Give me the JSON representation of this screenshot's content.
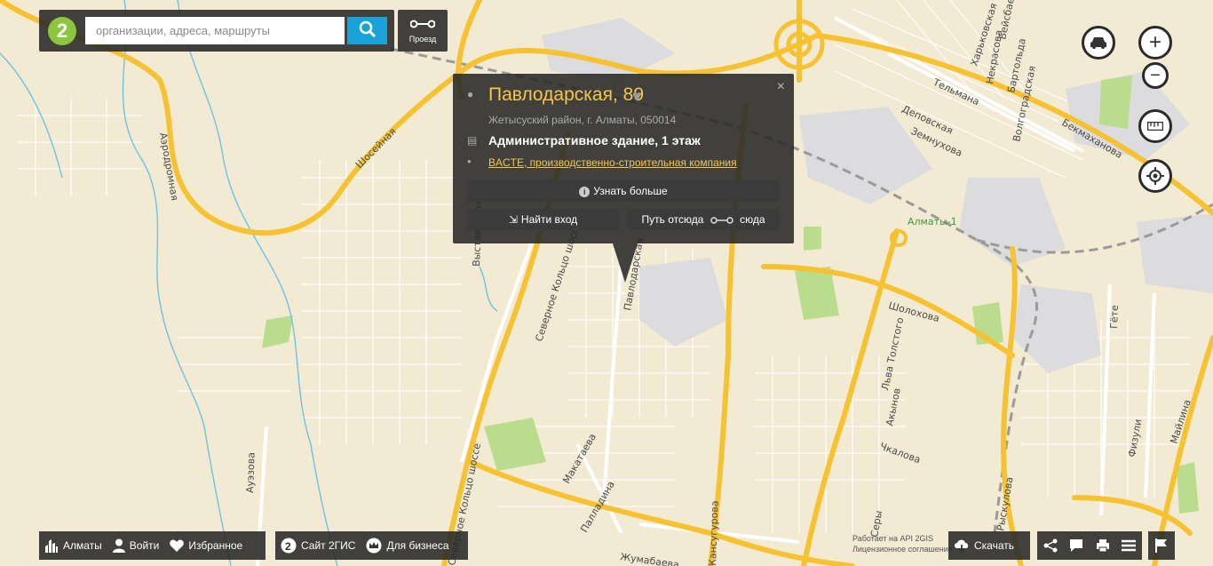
{
  "search": {
    "placeholder": "организации, адреса, маршруты",
    "route_label": "Проезд"
  },
  "popup": {
    "title": "Павлодарская, 89",
    "address": "Жетысуский район, г. Алматы, 050014",
    "building": "Административное здание, 1 этаж",
    "company": "BACTE, производственно-строительная компания",
    "learn_more": "Узнать больше",
    "find_entrance": "Найти вход",
    "route_from": "Путь отсюда",
    "route_to": "сюда",
    "close": "×"
  },
  "controls": {
    "traffic": "car-icon",
    "zoom_in": "+",
    "zoom_out": "−",
    "ruler": "ruler-icon",
    "locate": "locate-icon"
  },
  "bottom_left": {
    "city": "Алматы",
    "login": "Войти",
    "favorites": "Избранное",
    "site": "Сайт 2ГИС",
    "business": "Для бизнеса"
  },
  "bottom_right": {
    "download": "Скачать",
    "legal_line1": "Работает на API 2GIS",
    "legal_line2": "Лицензионное соглашение"
  },
  "map": {
    "streets": [
      {
        "name": "Шосейная"
      },
      {
        "name": "Северное Кольцо шоссе"
      },
      {
        "name": "Павлодарская"
      },
      {
        "name": "Шолохова"
      },
      {
        "name": "Льва Толстого"
      },
      {
        "name": "Акынов"
      },
      {
        "name": "Чкалова"
      },
      {
        "name": "Макатаева"
      },
      {
        "name": "Палладина"
      },
      {
        "name": "Жумабаева"
      },
      {
        "name": "Ауэзова"
      },
      {
        "name": "Харьковская"
      },
      {
        "name": "Тельмана"
      },
      {
        "name": "Деповская"
      },
      {
        "name": "Земнухова"
      },
      {
        "name": "Бекмаханова"
      },
      {
        "name": "Волгоградская"
      },
      {
        "name": "Бартольда"
      },
      {
        "name": "Некрасова"
      },
      {
        "name": "Бейсбаева"
      },
      {
        "name": "Гёте"
      },
      {
        "name": "Майлина"
      },
      {
        "name": "Физули"
      },
      {
        "name": "Кансугурова"
      },
      {
        "name": "Серы"
      },
      {
        "name": "Рыскулова"
      },
      {
        "name": "Выставочная"
      },
      {
        "name": "Северное Кольцо шоссе"
      },
      {
        "name": "Аэродромная"
      }
    ],
    "station": "Алматы-1",
    "colors": {
      "land": "#f2ead2",
      "road_major": "#f6c232",
      "road_minor": "#ffffff",
      "river": "#6cc3e4",
      "park": "#b9dc8d",
      "rail": "#9a9a9a",
      "industrial": "#dcdcde"
    }
  }
}
